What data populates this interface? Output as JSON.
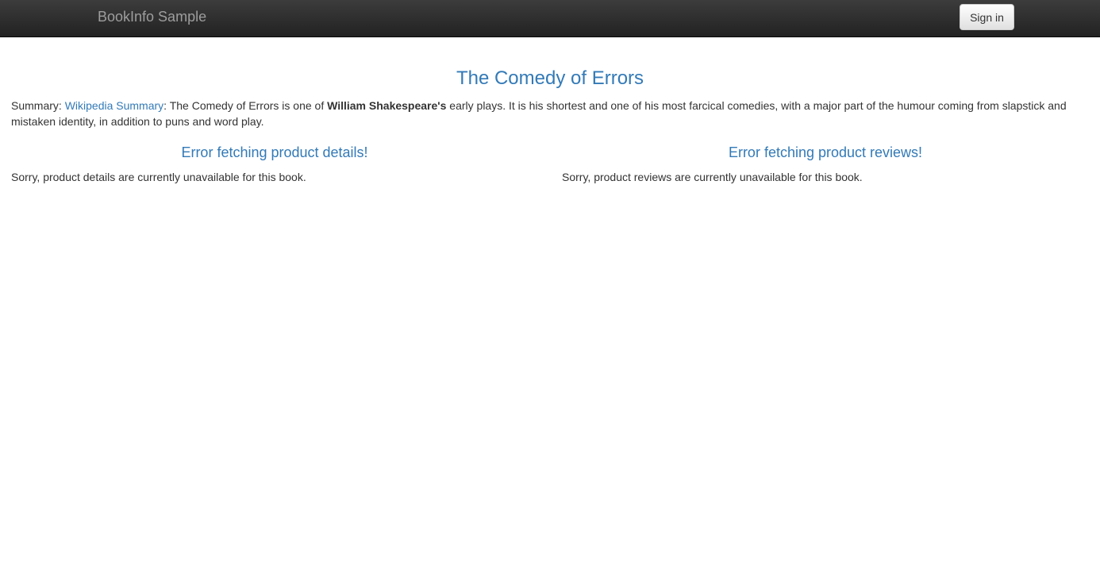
{
  "navbar": {
    "brand": "BookInfo Sample",
    "signin_label": "Sign in"
  },
  "product": {
    "title": "The Comedy of Errors",
    "summary": {
      "prefix": "Summary: ",
      "link_text": "Wikipedia Summary",
      "text_before_bold": ": The Comedy of Errors is one of ",
      "bold_text": "William Shakespeare's",
      "text_after_bold": " early plays. It is his shortest and one of his most farcical comedies, with a major part of the humour coming from slapstick and mistaken identity, in addition to puns and word play."
    }
  },
  "details": {
    "heading": "Error fetching product details!",
    "message": "Sorry, product details are currently unavailable for this book."
  },
  "reviews": {
    "heading": "Error fetching product reviews!",
    "message": "Sorry, product reviews are currently unavailable for this book."
  }
}
